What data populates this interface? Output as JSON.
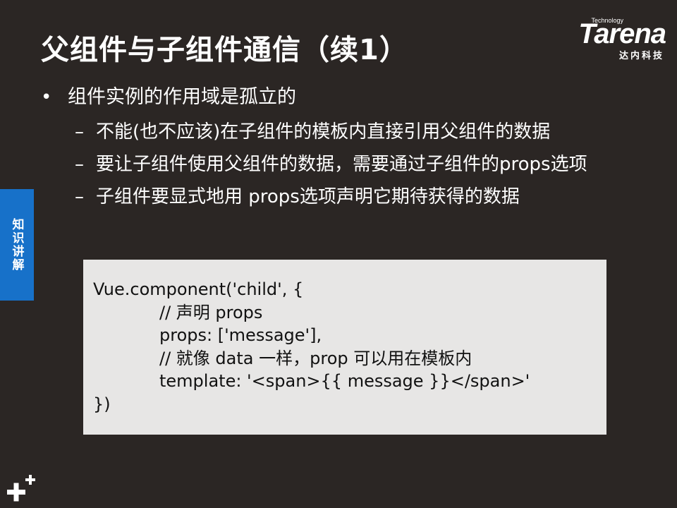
{
  "slide": {
    "title": "父组件与子组件通信（续1）",
    "logo": {
      "tech": "Technology",
      "brand": "Tarena",
      "brand_cn": "达内科技"
    },
    "side_tab": "知识讲解",
    "bullets": [
      {
        "level": 1,
        "mark": "•",
        "text": "组件实例的作用域是孤立的"
      },
      {
        "level": 2,
        "mark": "–",
        "text": "不能(也不应该)在子组件的模板内直接引用父组件的数据"
      },
      {
        "level": 2,
        "mark": "–",
        "text": "要让子组件使用父组件的数据，需要通过子组件的props选项"
      },
      {
        "level": 2,
        "mark": "–",
        "text": "子组件要显式地用 props选项声明它期待获得的数据"
      }
    ],
    "code": [
      "Vue.component('child', {",
      "// 声明 props",
      "props: ['message'],",
      "// 就像 data 一样，prop 可以用在模板内",
      "template: '<span>{{ message }}</span>'",
      "})"
    ]
  }
}
